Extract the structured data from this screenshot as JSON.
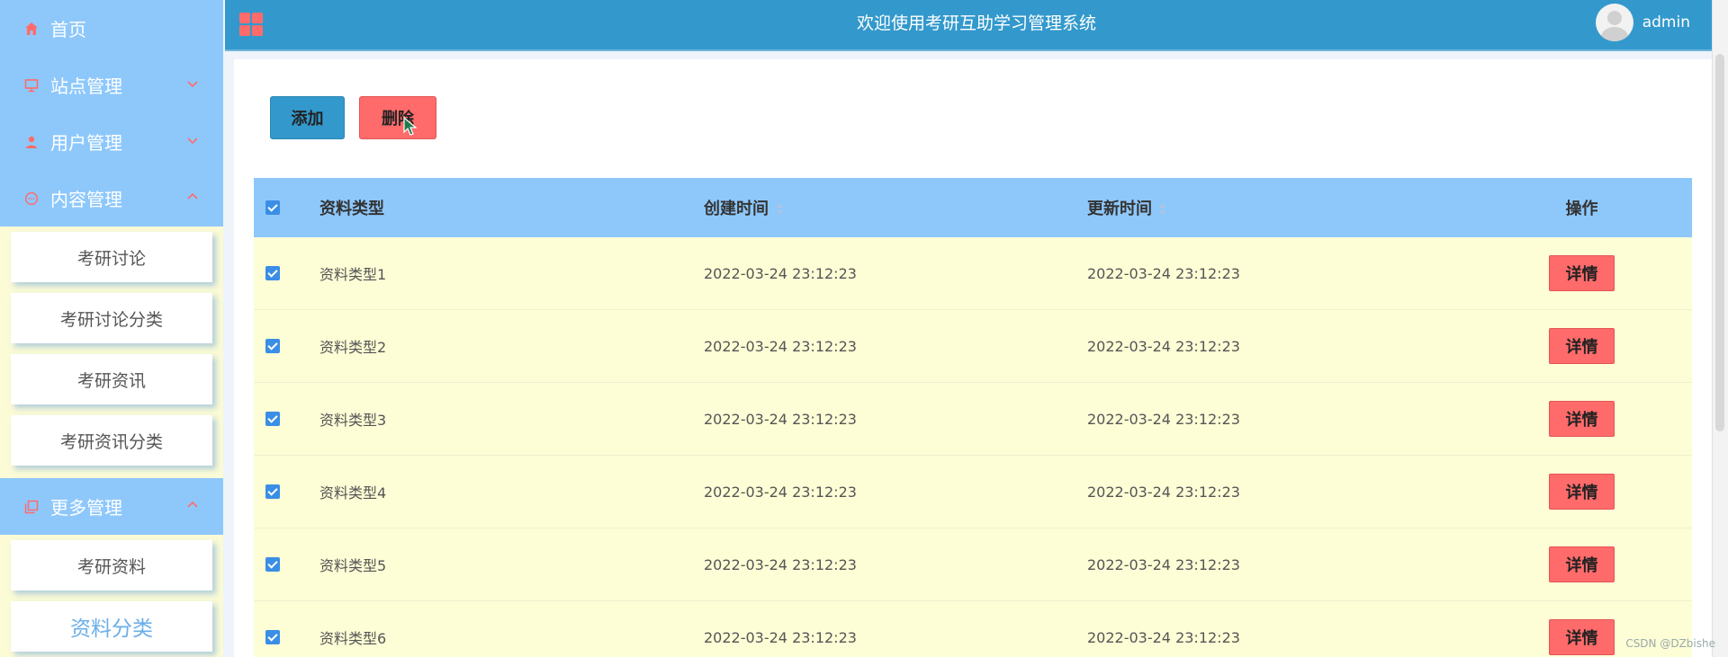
{
  "sidebar": {
    "items": [
      {
        "label": "首页",
        "icon": "home-icon"
      },
      {
        "label": "站点管理",
        "icon": "monitor-icon"
      },
      {
        "label": "用户管理",
        "icon": "user-icon"
      },
      {
        "label": "内容管理",
        "icon": "chat-icon"
      },
      {
        "label": "更多管理",
        "icon": "copy-icon"
      }
    ],
    "content_sub": [
      "考研讨论",
      "考研讨论分类",
      "考研资讯",
      "考研资讯分类"
    ],
    "more_sub": [
      "考研资料",
      "资料分类"
    ]
  },
  "header": {
    "title": "欢迎使用考研互助学习管理系统",
    "username": "admin"
  },
  "toolbar": {
    "add_label": "添加",
    "delete_label": "删除"
  },
  "table": {
    "columns": [
      "资料类型",
      "创建时间",
      "更新时间",
      "操作"
    ],
    "rows": [
      {
        "type": "资料类型1",
        "created": "2022-03-24 23:12:23",
        "updated": "2022-03-24 23:12:23",
        "action": "详情"
      },
      {
        "type": "资料类型2",
        "created": "2022-03-24 23:12:23",
        "updated": "2022-03-24 23:12:23",
        "action": "详情"
      },
      {
        "type": "资料类型3",
        "created": "2022-03-24 23:12:23",
        "updated": "2022-03-24 23:12:23",
        "action": "详情"
      },
      {
        "type": "资料类型4",
        "created": "2022-03-24 23:12:23",
        "updated": "2022-03-24 23:12:23",
        "action": "详情"
      },
      {
        "type": "资料类型5",
        "created": "2022-03-24 23:12:23",
        "updated": "2022-03-24 23:12:23",
        "action": "详情"
      },
      {
        "type": "资料类型6",
        "created": "2022-03-24 23:12:23",
        "updated": "2022-03-24 23:12:23",
        "action": "详情"
      }
    ]
  },
  "watermark": "CSDN @DZbishe",
  "colors": {
    "sidebar_blue": "#8ec8fb",
    "header_blue": "#3399cc",
    "accent_red": "#ff6b6b",
    "row_yellow": "#fdfdd6"
  }
}
